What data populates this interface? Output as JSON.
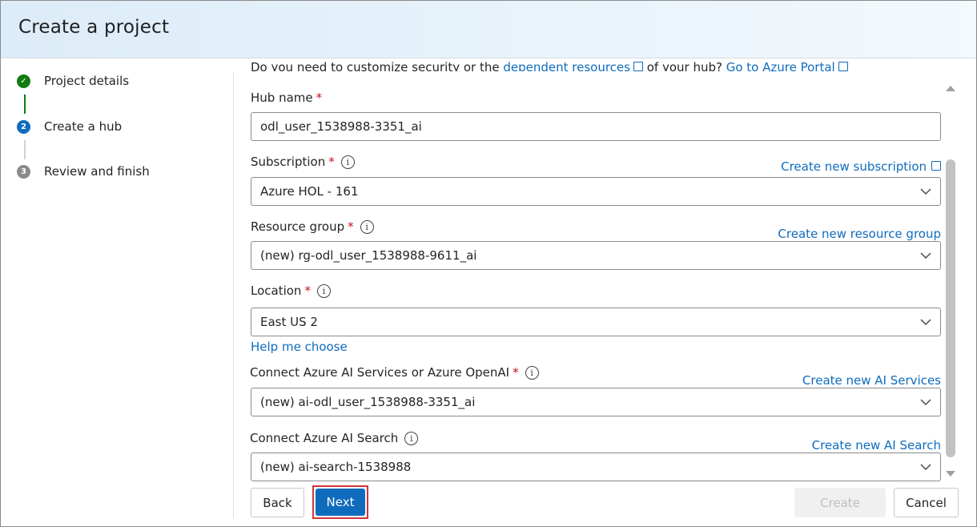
{
  "header": {
    "title": "Create a project"
  },
  "steps": [
    {
      "label": "Project details",
      "state": "completed",
      "marker": "✓"
    },
    {
      "label": "Create a hub",
      "state": "current",
      "marker": "2"
    },
    {
      "label": "Review and finish",
      "state": "pending",
      "marker": "3"
    }
  ],
  "form": {
    "intro": {
      "prefix": "Do you need to customize security or the ",
      "dependent_link": "dependent resources",
      "middle": " of your hub? ",
      "portal_link": "Go to Azure Portal"
    },
    "hub_name": {
      "label": "Hub name",
      "value": "odl_user_1538988-3351_ai"
    },
    "subscription": {
      "label": "Subscription",
      "value": "Azure HOL - 161",
      "create_link": "Create new subscription"
    },
    "resource_group": {
      "label": "Resource group",
      "value": "(new) rg-odl_user_1538988-9611_ai",
      "create_link": "Create new resource group"
    },
    "location": {
      "label": "Location",
      "value": "East US 2",
      "help_link": "Help me choose"
    },
    "ai_services": {
      "label": "Connect Azure AI Services or Azure OpenAI",
      "value": "(new) ai-odl_user_1538988-3351_ai",
      "create_link": "Create new AI Services"
    },
    "ai_search": {
      "label": "Connect Azure AI Search",
      "value": "(new) ai-search-1538988",
      "create_link": "Create new AI Search"
    },
    "required_mark": "*",
    "info_glyph": "i"
  },
  "buttons": {
    "back": "Back",
    "next": "Next",
    "create": "Create",
    "cancel": "Cancel"
  },
  "colors": {
    "accent": "#0f6cbd",
    "success": "#107c10",
    "required": "#c50f1f",
    "highlight": "#d13438"
  }
}
